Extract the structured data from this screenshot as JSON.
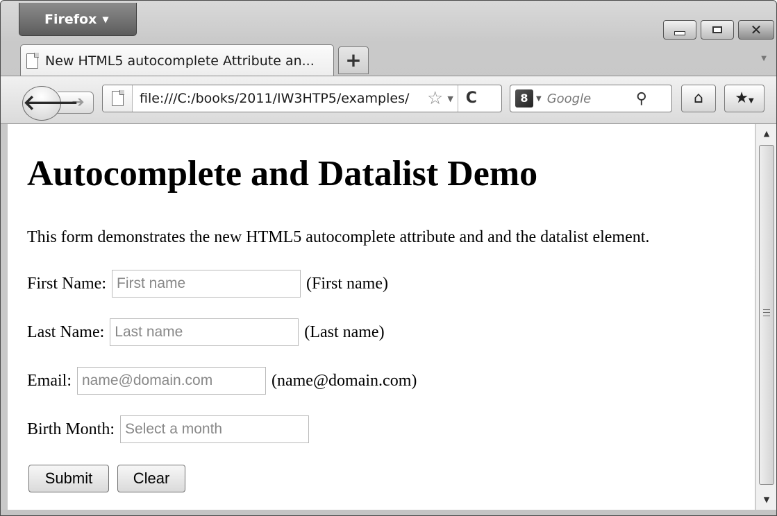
{
  "browser": {
    "menu_label": "Firefox",
    "tab_title": "New HTML5 autocomplete Attribute an...",
    "new_tab_label": "+",
    "url": "file:///C:/books/2011/IW3HTP5/examples/",
    "search_placeholder": "Google",
    "search_engine_label": "8"
  },
  "page": {
    "heading": "Autocomplete and Datalist Demo",
    "intro": "This form demonstrates the new HTML5 autocomplete attribute and and the datalist element.",
    "fields": [
      {
        "label": "First Name:",
        "placeholder": "First name",
        "hint": "(First name)"
      },
      {
        "label": "Last Name:",
        "placeholder": "Last name",
        "hint": "(Last name)"
      },
      {
        "label": "Email:",
        "placeholder": "name@domain.com",
        "hint": "(name@domain.com)"
      },
      {
        "label": "Birth Month:",
        "placeholder": "Select a month",
        "hint": ""
      }
    ],
    "buttons": {
      "submit": "Submit",
      "clear": "Clear"
    }
  }
}
